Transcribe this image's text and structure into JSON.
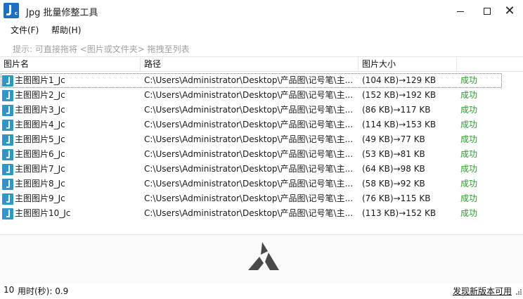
{
  "window": {
    "title": "Jpg 批量修整工具",
    "icon": "app-jc-icon"
  },
  "menu": {
    "file": "文件(F)",
    "help": "帮助(H)"
  },
  "hint": "提示: 可直接拖将 <图片或文件夹> 拖拽至列表",
  "table": {
    "columns": {
      "name": "图片名",
      "path": "路径",
      "size": "图片大小"
    },
    "rows": [
      {
        "name": "主图图片1_Jc",
        "path": "C:\\Users\\Administrator\\Desktop\\产品图\\记号笔\\主...",
        "size": "(104 KB)→129 KB",
        "status": "成功"
      },
      {
        "name": "主图图片2_Jc",
        "path": "C:\\Users\\Administrator\\Desktop\\产品图\\记号笔\\主...",
        "size": "(152 KB)→192 KB",
        "status": "成功"
      },
      {
        "name": "主图图片3_Jc",
        "path": "C:\\Users\\Administrator\\Desktop\\产品图\\记号笔\\主...",
        "size": "(86 KB)→117 KB",
        "status": "成功"
      },
      {
        "name": "主图图片4_Jc",
        "path": "C:\\Users\\Administrator\\Desktop\\产品图\\记号笔\\主...",
        "size": "(114 KB)→153 KB",
        "status": "成功"
      },
      {
        "name": "主图图片5_Jc",
        "path": "C:\\Users\\Administrator\\Desktop\\产品图\\记号笔\\主...",
        "size": "(49 KB)→77 KB",
        "status": "成功"
      },
      {
        "name": "主图图片6_Jc",
        "path": "C:\\Users\\Administrator\\Desktop\\产品图\\记号笔\\主...",
        "size": "(53 KB)→81 KB",
        "status": "成功"
      },
      {
        "name": "主图图片7_Jc",
        "path": "C:\\Users\\Administrator\\Desktop\\产品图\\记号笔\\主...",
        "size": "(64 KB)→98 KB",
        "status": "成功"
      },
      {
        "name": "主图图片8_Jc",
        "path": "C:\\Users\\Administrator\\Desktop\\产品图\\记号笔\\主...",
        "size": "(58 KB)→92 KB",
        "status": "成功"
      },
      {
        "name": "主图图片9_Jc",
        "path": "C:\\Users\\Administrator\\Desktop\\产品图\\记号笔\\主...",
        "size": "(76 KB)→115 KB",
        "status": "成功"
      },
      {
        "name": "主图图片10_Jc",
        "path": "C:\\Users\\Administrator\\Desktop\\产品图\\记号笔\\主...",
        "size": "(113 KB)→152 KB",
        "status": "成功"
      }
    ]
  },
  "status": {
    "count": "10",
    "time": "用时(秒): 0.9",
    "update": "发现新版本可用"
  },
  "colors": {
    "success": "#2e9b2e",
    "icon_blue": "#2f97c8",
    "app_blue": "#1f6fc1",
    "logo": "#4a4a4a"
  }
}
